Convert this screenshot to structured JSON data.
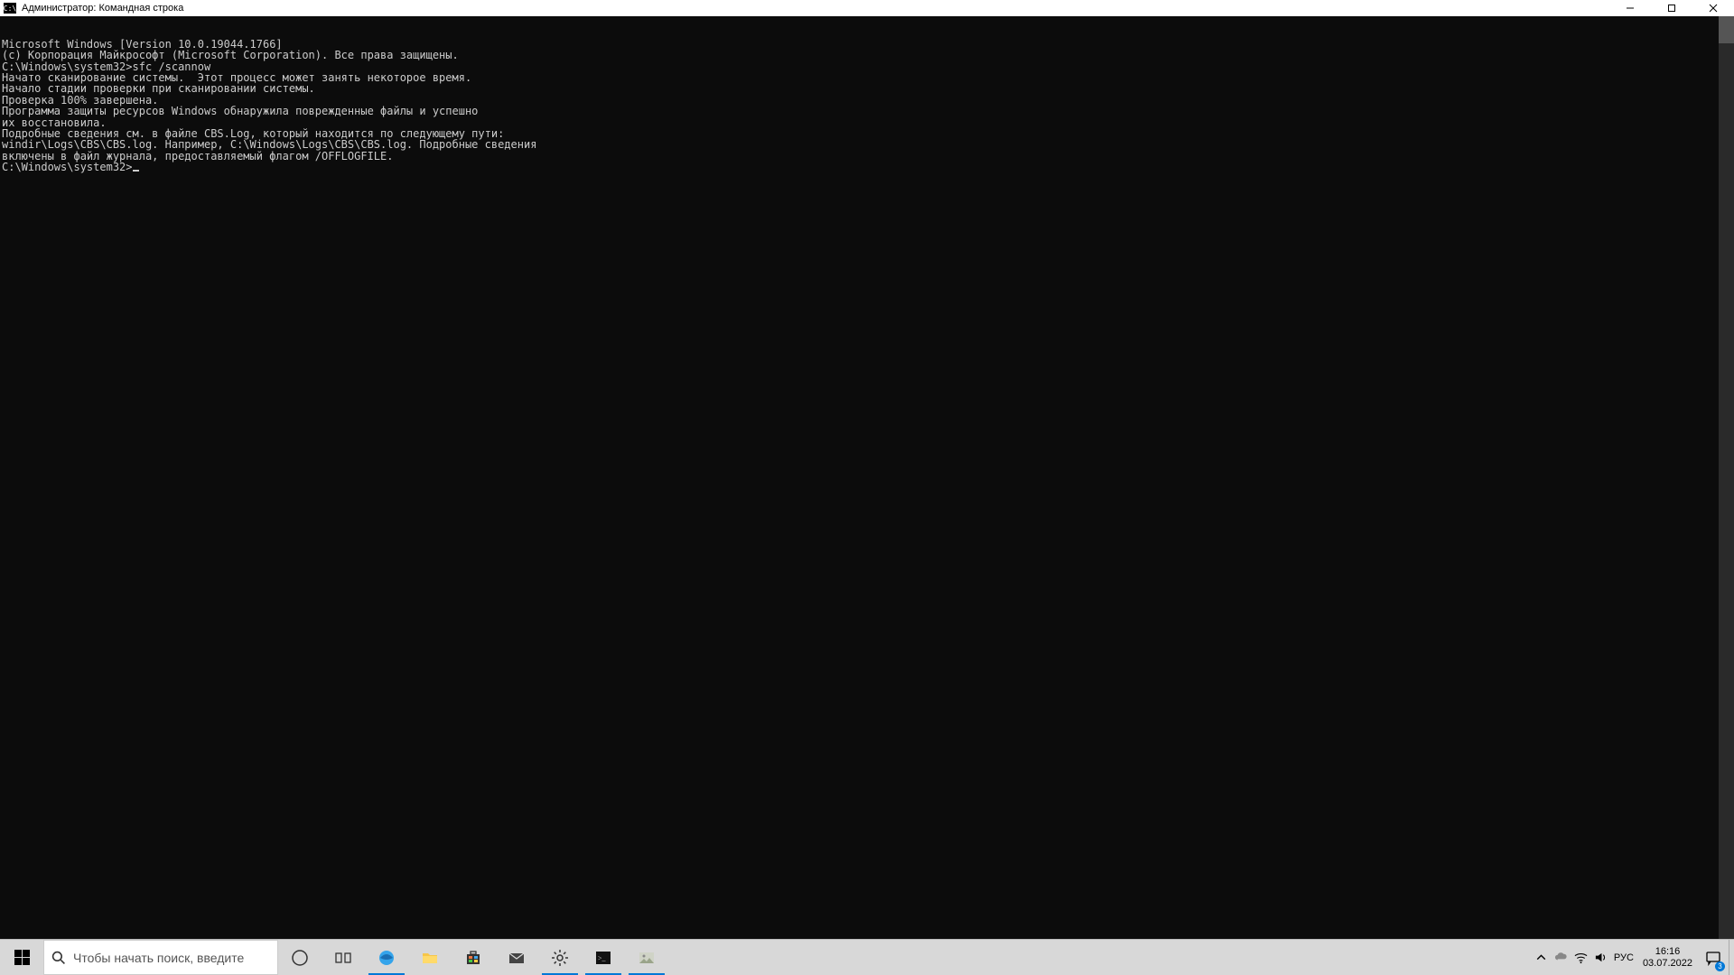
{
  "titlebar": {
    "icon_text": "C:\\",
    "title": "Администратор: Командная строка"
  },
  "terminal": {
    "lines": [
      "Microsoft Windows [Version 10.0.19044.1766]",
      "(c) Корпорация Майкрософт (Microsoft Corporation). Все права защищены.",
      "",
      "C:\\Windows\\system32>sfc /scannow",
      "",
      "Начато сканирование системы.  Этот процесс может занять некоторое время.",
      "",
      "Начало стадии проверки при сканировании системы.",
      "Проверка 100% завершена.",
      "",
      "Программа защиты ресурсов Windows обнаружила поврежденные файлы и успешно",
      "их восстановила.",
      "Подробные сведения см. в файле CBS.Log, который находится по следующему пути:",
      "windir\\Logs\\CBS\\CBS.log. Например, C:\\Windows\\Logs\\CBS\\CBS.log. Подробные сведения",
      "включены в файл журнала, предоставляемый флагом /OFFLOGFILE.",
      "",
      "C:\\Windows\\system32>"
    ]
  },
  "taskbar": {
    "search_placeholder": "Чтобы начать поиск, введите"
  },
  "tray": {
    "lang": "РУС",
    "time": "16:16",
    "date": "03.07.2022",
    "notif_count": "3"
  }
}
